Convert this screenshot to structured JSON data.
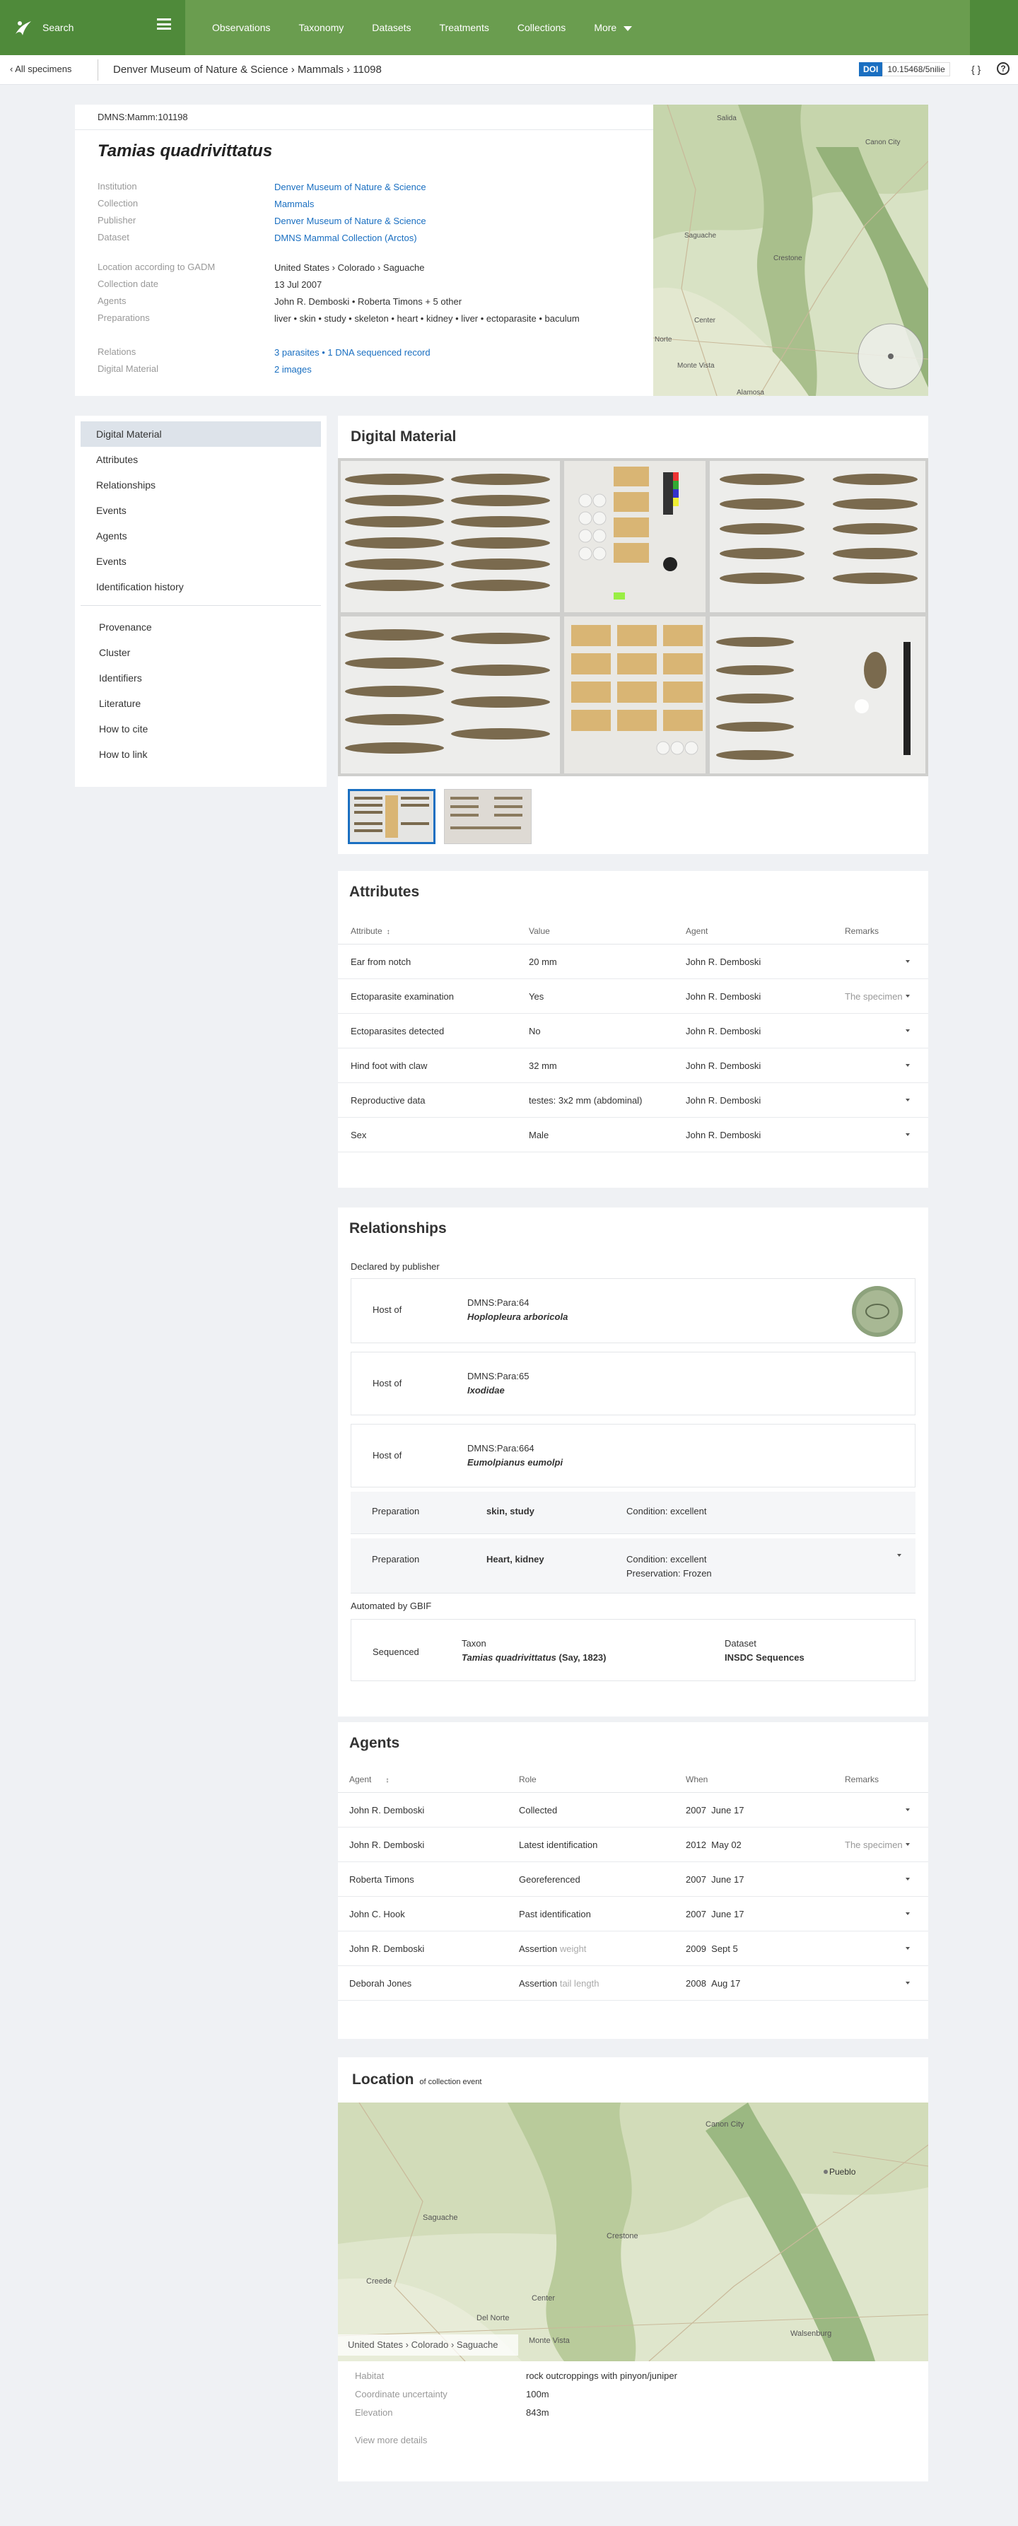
{
  "nav": {
    "search_label": "Search",
    "links": [
      "Observations",
      "Taxonomy",
      "Datasets",
      "Treatments",
      "Collections",
      "More"
    ]
  },
  "breadcrumb": {
    "back_label": "All specimens",
    "path": "Denver Museum of Nature & Science › Mammals › 11098",
    "doi_badge": "DOI",
    "doi_value": "10.15468/5nilie",
    "code_symbol": "{ }",
    "help_symbol": "?"
  },
  "specimen": {
    "catalog_number": "DMNS:Mamm:101198",
    "scientific_name": "Tamias quadrivittatus",
    "fields": [
      {
        "key": "Institution",
        "value": "Denver Museum of Nature & Science",
        "link": true
      },
      {
        "key": "Collection",
        "value": "Mammals",
        "link": true
      },
      {
        "key": "Publisher",
        "value": "Denver Museum of Nature & Science",
        "link": true
      },
      {
        "key": "Dataset",
        "value": "DMNS Mammal Collection (Arctos)",
        "link": true
      }
    ],
    "fields2": [
      {
        "key": "Location according to GADM",
        "value": "United States › Colorado › Saguache",
        "link": false
      },
      {
        "key": "Collection date",
        "value": "13 Jul 2007",
        "link": false
      },
      {
        "key": "Agents",
        "value": "John R. Demboski • Roberta Timons + 5 other",
        "link": false
      },
      {
        "key": "Preparations",
        "value": "liver • skin • study • skeleton • heart • kidney • liver • ectoparasite • baculum",
        "link": false
      }
    ],
    "fields3": [
      {
        "key": "Relations",
        "value": "3 parasites • 1 DNA sequenced record",
        "link": true
      },
      {
        "key": "Digital Material",
        "value": "2 images",
        "link": true
      }
    ]
  },
  "map_labels": {
    "head": [
      "Salida",
      "Canon City",
      "Saguache",
      "Crestone",
      "Center",
      "Monte Vista",
      "Norte",
      "Alamosa"
    ],
    "location": [
      "Canon City",
      "Pueblo",
      "Saguache",
      "Crestone",
      "Creede",
      "Center",
      "Del Norte",
      "Monte Vista",
      "Walsenburg"
    ]
  },
  "sidenav": {
    "items": [
      "Digital Material",
      "Attributes",
      "Relationships",
      "Events",
      "Agents",
      "Events",
      "Identification history"
    ],
    "items2": [
      "Provenance",
      "Cluster",
      "Identifiers",
      "Literature",
      "How to cite",
      "How to link"
    ]
  },
  "digital_material": {
    "title": "Digital Material"
  },
  "attributes": {
    "title": "Attributes",
    "headers": [
      "Attribute",
      "Value",
      "Agent",
      "Remarks"
    ],
    "rows": [
      [
        "Ear from notch",
        "20 mm",
        "John R. Demboski",
        ""
      ],
      [
        "Ectoparasite examination",
        "Yes",
        "John R. Demboski",
        "The specimen"
      ],
      [
        "Ectoparasites detected",
        "No",
        "John R. Demboski",
        ""
      ],
      [
        "Hind foot with claw",
        "32 mm",
        "John R. Demboski",
        ""
      ],
      [
        "Reproductive data",
        "testes: 3x2 mm (abdominal)",
        "John R. Demboski",
        ""
      ],
      [
        "Sex",
        "Male",
        "John R. Demboski",
        ""
      ]
    ]
  },
  "relationships": {
    "title": "Relationships",
    "declared_label": "Declared by publisher",
    "hosts": [
      {
        "type": "Host of",
        "id": "DMNS:Para:64",
        "taxon": "Hoplopleura arboricola"
      },
      {
        "type": "Host of",
        "id": "DMNS:Para:65",
        "taxon": "Ixodidae"
      },
      {
        "type": "Host of",
        "id": "DMNS:Para:664",
        "taxon": "Eumolpianus eumolpi"
      }
    ],
    "preparations": [
      {
        "type": "Preparation",
        "value": "skin, study",
        "cond": "Condition: excellent",
        "pres": ""
      },
      {
        "type": "Preparation",
        "value": "Heart, kidney",
        "cond": "Condition: excellent",
        "pres": "Preservation: Frozen"
      }
    ],
    "automated_label": "Automated by GBIF",
    "sequenced": {
      "type": "Sequenced",
      "taxon_key": "Taxon",
      "taxon_val": "Tamias quadrivittatus",
      "author": "(Say, 1823)",
      "dataset_key": "Dataset",
      "dataset_val": "INSDC Sequences"
    }
  },
  "agents": {
    "title": "Agents",
    "headers": [
      "Agent",
      "Role",
      "When",
      "Remarks"
    ],
    "rows": [
      {
        "agent": "John R. Demboski",
        "role": "Collected",
        "role_extra": "",
        "year": "2007",
        "date": "June 17",
        "remarks": ""
      },
      {
        "agent": "John R. Demboski",
        "role": "Latest identification",
        "role_extra": "",
        "year": "2012",
        "date": "May 02",
        "remarks": "The specimen"
      },
      {
        "agent": "Roberta Timons",
        "role": "Georeferenced",
        "role_extra": "",
        "year": "2007",
        "date": "June 17",
        "remarks": ""
      },
      {
        "agent": "John C. Hook",
        "role": "Past identification",
        "role_extra": "",
        "year": "2007",
        "date": "June 17",
        "remarks": ""
      },
      {
        "agent": "John R. Demboski",
        "role": "Assertion",
        "role_extra": "weight",
        "year": "2009",
        "date": "Sept 5",
        "remarks": ""
      },
      {
        "agent": "Deborah Jones",
        "role": "Assertion",
        "role_extra": "tail length",
        "year": "2008",
        "date": "Aug 17",
        "remarks": ""
      }
    ]
  },
  "location": {
    "title": "Location",
    "subtitle": "of collection event",
    "gadm": "United States › Colorado › Saguache",
    "details": [
      {
        "key": "Habitat",
        "value": "rock outcroppings with pinyon/juniper"
      },
      {
        "key": "Coordinate uncertainty",
        "value": "100m"
      },
      {
        "key": "Elevation",
        "value": "843m"
      }
    ],
    "view_more": "View more details"
  },
  "colors": {
    "nav_green": "#6a9d4f",
    "nav_green_dark": "#4f8a3a",
    "link_blue": "#1a6fc1",
    "page_bg": "#eff1f4"
  }
}
